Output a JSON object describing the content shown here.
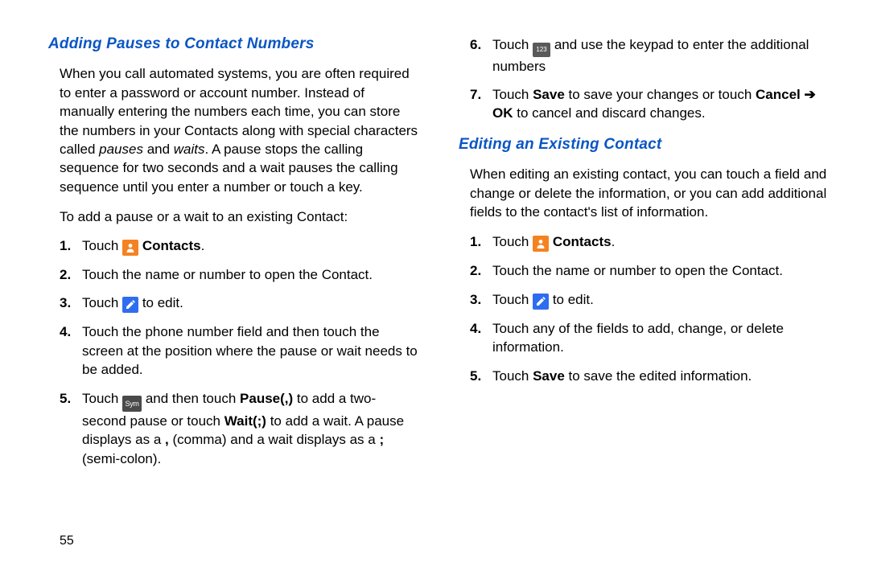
{
  "page_number": "55",
  "left": {
    "heading": "Adding Pauses to Contact Numbers",
    "intro_a": "When you call automated systems, you are often required to enter a password or account number. Instead of manually entering the numbers each time, you can store the numbers in your Contacts along with special characters called ",
    "intro_pauses": "pauses",
    "intro_b": " and ",
    "intro_waits": "waits",
    "intro_c": ". A pause stops the calling sequence for two seconds and a wait pauses the calling sequence until you enter a number or touch a key.",
    "lead": "To add a pause or a wait to an existing Contact:",
    "s1_pre": "Touch ",
    "s1_post": " ",
    "s1_contacts": "Contacts",
    "s1_dot": ".",
    "s2": "Touch the name or number to open the Contact.",
    "s3_pre": "Touch ",
    "s3_post": " to edit.",
    "s4": "Touch the phone number field and then touch the screen at the position where the pause or wait needs to be added.",
    "s5_a": "Touch ",
    "s5_sym": "Sym",
    "s5_b": " and then touch ",
    "s5_pause": "Pause(,)",
    "s5_c": " to add a two-second pause or touch ",
    "s5_wait": "Wait(;)",
    "s5_d": " to add a wait. A pause displays as a ",
    "s5_comma": ",",
    "s5_e": " (comma) and a wait displays as a ",
    "s5_semi": ";",
    "s5_f": " (semi-colon)."
  },
  "right": {
    "s6_a": "Touch ",
    "s6_key": "123",
    "s6_b": " and use the keypad to enter the additional numbers",
    "s7_a": "Touch ",
    "s7_save": "Save",
    "s7_b": " to save your changes or touch ",
    "s7_cancel": "Cancel",
    "s7_arrow": " ➔ ",
    "s7_ok": "OK",
    "s7_c": " to cancel and discard changes.",
    "heading": "Editing an Existing Contact",
    "intro": "When editing an existing contact, you can touch a field and change or delete the information, or you can add additional fields to the contact's list of information.",
    "e1_pre": "Touch ",
    "e1_contacts": "Contacts",
    "e1_dot": ".",
    "e2": "Touch the name or number to open the Contact.",
    "e3_pre": "Touch ",
    "e3_post": " to edit.",
    "e4": "Touch any of the fields to add, change, or delete information.",
    "e5_a": "Touch ",
    "e5_save": "Save",
    "e5_b": " to save the edited information."
  }
}
